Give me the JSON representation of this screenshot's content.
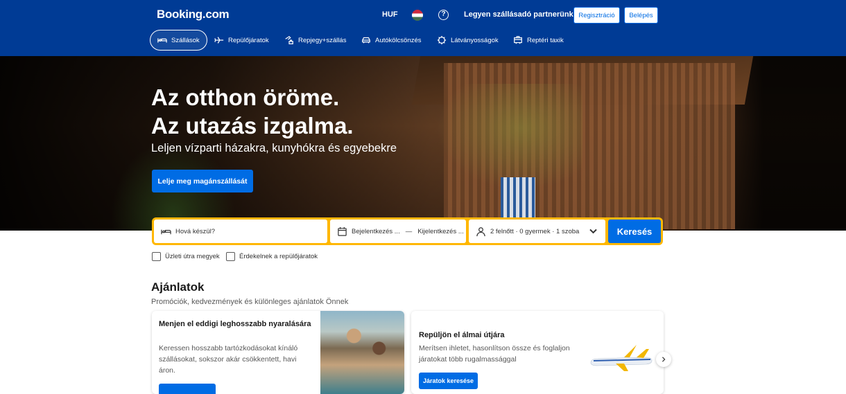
{
  "header": {
    "logo": "Booking.com",
    "currency": "HUF",
    "language_icon": "hungary-flag-icon",
    "help_icon": "question-circle-icon",
    "partner_link": "Legyen szállásadó partnerünk",
    "register_label": "Regisztráció",
    "login_label": "Belépés",
    "bg_color": "#003b95"
  },
  "nav": {
    "items": [
      {
        "label": "Szállások",
        "icon": "bed-icon",
        "active": true
      },
      {
        "label": "Repülőjáratok",
        "icon": "plane-icon",
        "active": false
      },
      {
        "label": "Repjegy+szállás",
        "icon": "flight-hotel-icon",
        "active": false
      },
      {
        "label": "Autókölcsönzés",
        "icon": "car-icon",
        "active": false
      },
      {
        "label": "Látványosságok",
        "icon": "attractions-icon",
        "active": false
      },
      {
        "label": "Reptéri taxik",
        "icon": "taxi-icon",
        "active": false
      }
    ]
  },
  "hero": {
    "title_line1": "Az otthon öröme.",
    "title_line2": "Az utazás izgalma.",
    "subtitle": "Leljen vízparti házakra, kunyhókra és egyebekre",
    "cta_label": "Lelje meg magánszállását"
  },
  "search": {
    "destination_placeholder": "Hová készül?",
    "checkin_label": "Bejelentkezés ...",
    "date_separator": "—",
    "checkout_label": "Kijelentkezés ...",
    "guests_label": "2 felnőtt · 0 gyermek · 1 szoba",
    "search_button": "Keresés",
    "border_color": "#ffb700"
  },
  "options": {
    "business_trip": "Üzleti útra megyek",
    "flights_interest": "Érdekelnek a repülőjáratok"
  },
  "offers": {
    "title": "Ajánlatok",
    "subtitle": "Promóciók, kedvezmények és különleges ajánlatok Önnek",
    "cards": [
      {
        "title": "Menjen el eddigi leghosszabb nyaralására",
        "text": "Keressen hosszabb tartózkodásokat kínáló szállásokat, sokszor akár csökkentett, havi áron."
      },
      {
        "title": "Repüljön el álmai útjára",
        "text": "Merítsen ihletet, hasonlítson össze és foglaljon járatokat több rugalmassággal",
        "button": "Járatok keresése"
      }
    ]
  }
}
